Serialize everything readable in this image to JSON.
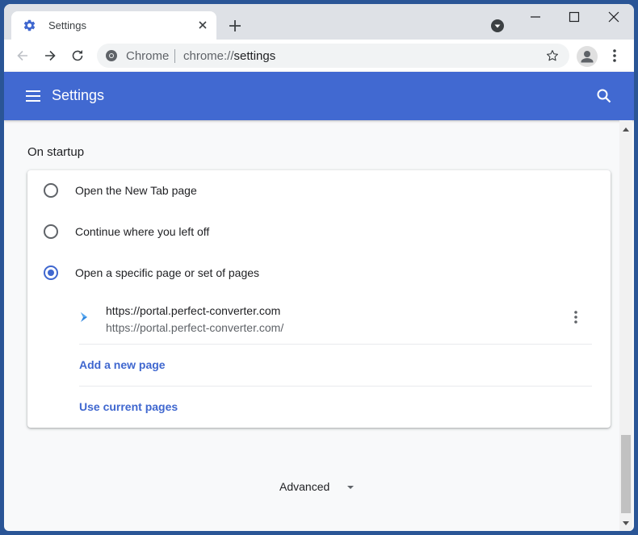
{
  "browser": {
    "tab": {
      "title": "Settings",
      "icon": "gear-icon"
    },
    "omnibox": {
      "chip": "Chrome",
      "url_scheme": "chrome://",
      "url_path": "settings"
    }
  },
  "header": {
    "title": "Settings"
  },
  "startup": {
    "section_title": "On startup",
    "options": [
      {
        "label": "Open the New Tab page",
        "selected": false
      },
      {
        "label": "Continue where you left off",
        "selected": false
      },
      {
        "label": "Open a specific page or set of pages",
        "selected": true
      }
    ],
    "pages": [
      {
        "title": "https://portal.perfect-converter.com",
        "url": "https://portal.perfect-converter.com/"
      }
    ],
    "add_page_label": "Add a new page",
    "use_current_label": "Use current pages"
  },
  "advanced_label": "Advanced",
  "colors": {
    "accent": "#3f67cf",
    "header": "#4169d1",
    "frame": "#2a5596"
  },
  "scroll": {
    "position_fraction": 0.95
  }
}
